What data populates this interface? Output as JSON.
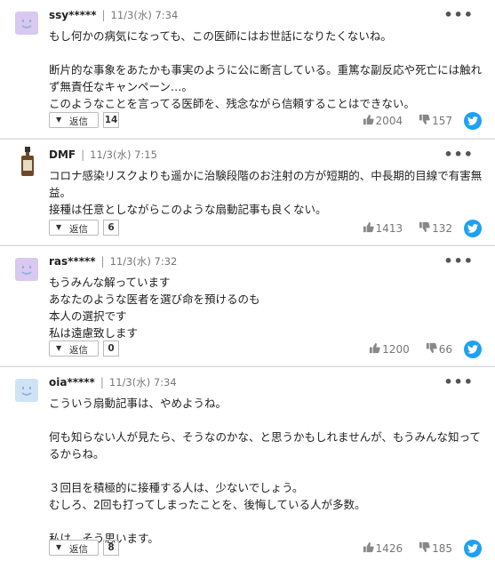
{
  "reply_label": "返信",
  "colors": {
    "twitter": "#1da1f2",
    "avatar_purple": "#d9c8ef",
    "avatar_blue": "#cfe3f5"
  },
  "comments": [
    {
      "username": "ssy*****",
      "date": "11/3(水) 7:34",
      "avatar": "smile-purple",
      "body": "もし何かの病気になっても、この医師にはお世話になりたくないね。\n\n断片的な事象をあたかも事実のように公に断言している。重篤な副反応や死亡には触れず無責任なキャンペーン…。\nこのようなことを言ってる医師を、残念ながら信頼することはできない。",
      "reply_count": "14",
      "likes": "2004",
      "dislikes": "157"
    },
    {
      "username": "DMF",
      "date": "11/3(水) 7:15",
      "avatar": "bottle",
      "body": "コロナ感染リスクよりも遥かに治験段階のお注射の方が短期的、中長期的目線で有害無益。\n接種は任意としながらこのような扇動記事も良くない。",
      "reply_count": "6",
      "likes": "1413",
      "dislikes": "132"
    },
    {
      "username": "ras*****",
      "date": "11/3(水) 7:32",
      "avatar": "smile-purple",
      "body": "もうみんな解っています\nあなたのような医者を選び命を預けるのも\n本人の選択です\n私は遠慮致します",
      "reply_count": "0",
      "likes": "1200",
      "dislikes": "66"
    },
    {
      "username": "oia*****",
      "date": "11/3(水) 7:34",
      "avatar": "smile-blue",
      "body": "こういう扇動記事は、やめようね。\n\n何も知らない人が見たら、そうなのかな、と思うかもしれませんが、もうみんな知ってるからね。\n\n３回目を積極的に接種する人は、少ないでしょう。\nむしろ、2回も打ってしまったことを、後悔している人が多数。\n\n私は、そう思います。",
      "reply_count": "8",
      "likes": "1426",
      "dislikes": "185"
    }
  ]
}
